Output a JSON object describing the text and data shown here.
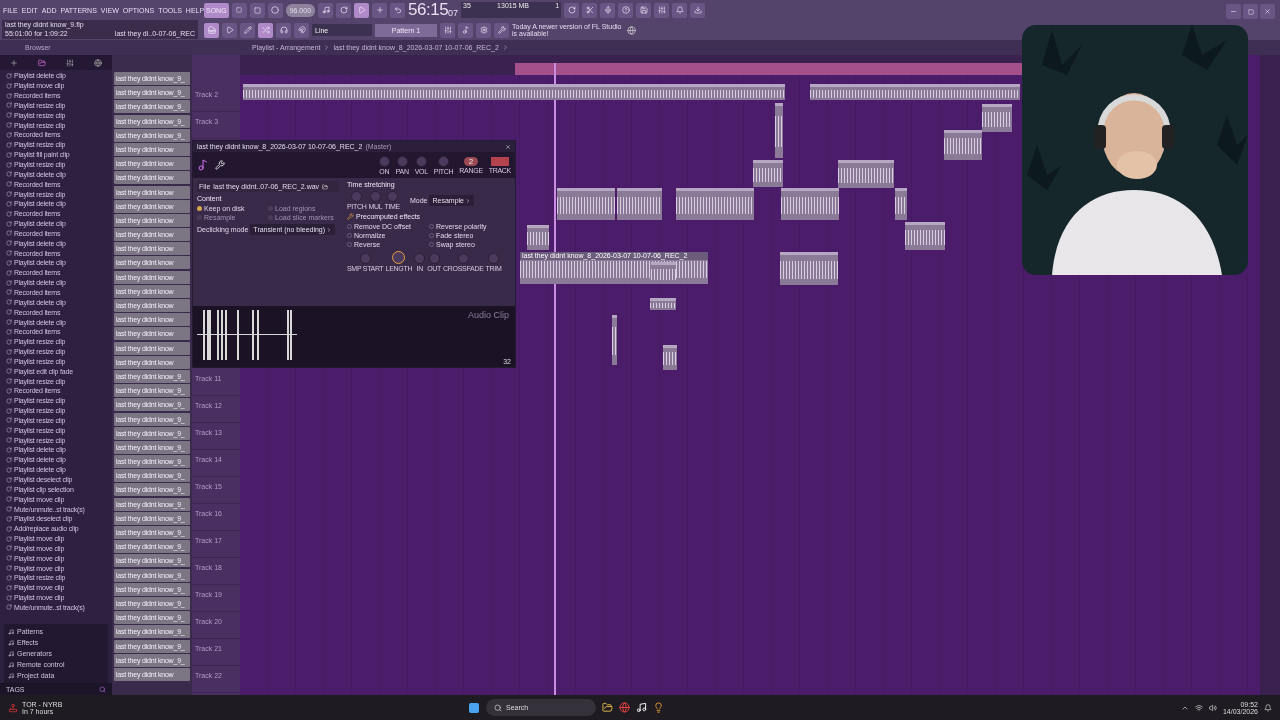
{
  "menu": [
    "FILE",
    "EDIT",
    "ADD",
    "PATTERNS",
    "VIEW",
    "OPTIONS",
    "TOOLS",
    "HELP"
  ],
  "hint_panel": {
    "lines": [
      "last they didnt know_9.flp",
      "55:01:00 for 1:09:22"
    ],
    "side": "last they di..0-07-06_REC"
  },
  "transport": {
    "mode": {
      "label": "SONG",
      "selected": true
    },
    "tempo": "96.000",
    "time": "56:15",
    "time_small": "07",
    "cpu": "35",
    "memory": "13015 MB",
    "polyphony": "1"
  },
  "toolbar2": {
    "snap": "Line",
    "pattern": "Pattern 1"
  },
  "notification": {
    "day": "Today",
    "message": "A newer version of FL Studio is available!"
  },
  "browser": {
    "title": "Browser",
    "history": [
      "Playlist delete clip",
      "Playlist move clip",
      "Recorded items",
      "Playlist resize clip",
      "Playlist resize clip",
      "Playlist resize clip",
      "Recorded items",
      "Playlist resize clip",
      "Playlist fill paint clip",
      "Playlist resize clip",
      "Playlist delete clip",
      "Recorded items",
      "Playlist resize clip",
      "Playlist delete clip",
      "Recorded items",
      "Playlist delete clip",
      "Recorded items",
      "Playlist delete clip",
      "Recorded items",
      "Playlist delete clip",
      "Recorded items",
      "Playlist delete clip",
      "Recorded items",
      "Playlist delete clip",
      "Recorded items",
      "Playlist delete clip",
      "Recorded items",
      "Playlist resize clip",
      "Playlist resize clip",
      "Playlist resize clip",
      "Playlist edit clip fade",
      "Playlist resize clip",
      "Recorded items",
      "Playlist resize clip",
      "Playlist resize clip",
      "Playlist resize clip",
      "Playlist resize clip",
      "Playlist resize clip",
      "Playlist delete clip",
      "Playlist delete clip",
      "Playlist delete clip",
      "Playlist deselect clip",
      "Playlist clip selection",
      "Playlist move clip",
      "Mute/unmute..st track(s)",
      "Playlist deselect clip",
      "Add/replace audio clip",
      "Playlist move clip",
      "Playlist move clip",
      "Playlist move clip",
      "Playlist move clip",
      "Playlist resize clip",
      "Playlist move clip",
      "Playlist move clip",
      "Mute/unmute..st track(s)"
    ],
    "folders": [
      "Patterns",
      "Effects",
      "Generators",
      "Remote control",
      "Project data"
    ],
    "tags": "TAGS"
  },
  "clip_list": [
    "last they didnt know_9_",
    "last they didnt know_9_",
    "last they didnt know_9_",
    "last they didnt know_9_",
    "last they didnt know_9_",
    "last they didnt know",
    "last they didnt know",
    "last they didnt know",
    "last they didnt know",
    "last they didnt know",
    "last they didnt know",
    "last they didnt know",
    "last they didnt know",
    "last they didnt know",
    "last they didnt know",
    "last they didnt know",
    "last they didnt know",
    "last they didnt know",
    "last they didnt know",
    "last they didnt know",
    "last they didnt know",
    "last they didnt know_9_",
    "last they didnt know_9_",
    "last they didnt know_9_",
    "last they didnt know_9_",
    "last they didnt know_9_",
    "last they didnt know_9_",
    "last they didnt know_9_",
    "last they didnt know_9_",
    "last they didnt know_9_",
    "last they didnt know_9_",
    "last they didnt know_9_",
    "last they didnt know_9_",
    "last they didnt know_9_",
    "last they didnt know_9_",
    "last they didnt know_9_",
    "last they didnt know_9_",
    "last they didnt know_9_",
    "last they didnt know_9_",
    "last they didnt know_9_",
    "last they didnt know_9_",
    "last they didnt know_9_",
    "last they didnt know"
  ],
  "playlist": {
    "title": "Playlist - Arrangement",
    "breadcrumb": "last they didnt know_8_2026-03-07 10-07-06_REC_2",
    "tracks_top": [
      "Track 2",
      "Track 3"
    ],
    "tracks_bottom": [
      "Track 11",
      "Track 12",
      "Track 13",
      "Track 14",
      "Track 15",
      "Track 16",
      "Track 17",
      "Track 18",
      "Track 19",
      "Track 20",
      "Track 21",
      "Track 22"
    ],
    "clip_label": "last they didnt know_8_2026-03-07 10-07-06_REC_2"
  },
  "audio_clip": {
    "title": "last they didnt know_8_2026-03-07 10-07-06_REC_2",
    "target": "(Master)",
    "knobs_top": [
      "ON",
      "PAN",
      "VOL",
      "PITCH"
    ],
    "range": {
      "label": "RANGE",
      "value": "2"
    },
    "track_label": "TRACK",
    "file_label": "File",
    "file_name": "last they didnt..07-06_REC_2.wav",
    "content_title": "Content",
    "content_options": [
      {
        "label": "Keep on disk",
        "selected": true,
        "disabled": false
      },
      {
        "label": "Load regions",
        "selected": false,
        "disabled": true
      },
      {
        "label": "Resample",
        "selected": false,
        "disabled": true
      },
      {
        "label": "Load slice markers",
        "selected": false,
        "disabled": true
      }
    ],
    "declick_label": "Declicking mode",
    "declick_value": "Transient (no bleeding)",
    "stretch_title": "Time stretching",
    "stretch_knobs": [
      "PITCH",
      "MUL",
      "TIME"
    ],
    "mode_label": "Mode",
    "mode_value": "Resample",
    "effects_title": "Precomputed effects",
    "effects": [
      {
        "label": "Remove DC offset",
        "checked": false
      },
      {
        "label": "Reverse polarity",
        "checked": false
      },
      {
        "label": "Normalize",
        "checked": false
      },
      {
        "label": "Fade stereo",
        "checked": false
      },
      {
        "label": "Reverse",
        "checked": false
      },
      {
        "label": "Swap stereo",
        "checked": false
      }
    ],
    "bottom_knobs": [
      {
        "label": "SMP START",
        "selected": false
      },
      {
        "label": "LENGTH",
        "selected": true
      },
      {
        "label": "IN",
        "selected": false
      },
      {
        "label": "OUT",
        "selected": false
      },
      {
        "label": "CROSSFADE",
        "selected": false
      },
      {
        "label": "TRIM",
        "selected": false
      }
    ],
    "caption": "Audio Clip",
    "zoom": "32"
  },
  "taskbar": {
    "widget_title": "TOR - NYRB",
    "widget_sub": "In 7 hours",
    "search": "Search",
    "time": "09:52",
    "date": "14/03/2026"
  }
}
